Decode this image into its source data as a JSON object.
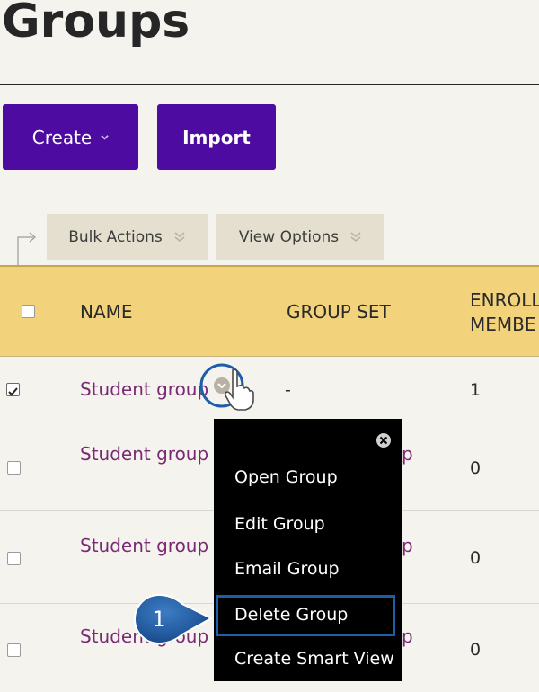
{
  "page": {
    "title": "Groups"
  },
  "actions": {
    "create_label": "Create",
    "import_label": "Import"
  },
  "toolbar": {
    "bulk_actions_label": "Bulk Actions",
    "view_options_label": "View Options"
  },
  "table": {
    "headers": {
      "name": "NAME",
      "group_set": "GROUP SET",
      "enrolled_line1": "ENROLL",
      "enrolled_line2": "MEMBE"
    },
    "rows": [
      {
        "name": "Student group",
        "group_set": "-",
        "enrolled": "1",
        "checked": true
      },
      {
        "name": "Student group",
        "group_set_fragment": "p",
        "enrolled": "0",
        "checked": false
      },
      {
        "name": "Student group",
        "group_set_fragment": "p",
        "enrolled": "0",
        "checked": false
      },
      {
        "name": "Student group",
        "group_set_fragment": "p",
        "enrolled": "0",
        "checked": false
      }
    ]
  },
  "context_menu": {
    "items": [
      "Open Group",
      "Edit Group",
      "Email Group",
      "Delete Group",
      "Create Smart View"
    ],
    "highlighted": "Delete Group"
  },
  "callout": {
    "number": "1"
  },
  "colors": {
    "primary_button": "#4e0ba1",
    "header_bg": "#f2d27a",
    "link": "#7a2a74",
    "menu_bg": "#000000",
    "highlight": "#1e5ea8",
    "callout": "#1e5ea8"
  },
  "icons": {
    "create_chevron": "chevron-down-icon",
    "toolbar_chevron": "double-chevron-down-icon",
    "menu_close": "close-circle-icon",
    "row_action": "chevron-circle-icon",
    "cursor": "hand-pointer-icon"
  }
}
